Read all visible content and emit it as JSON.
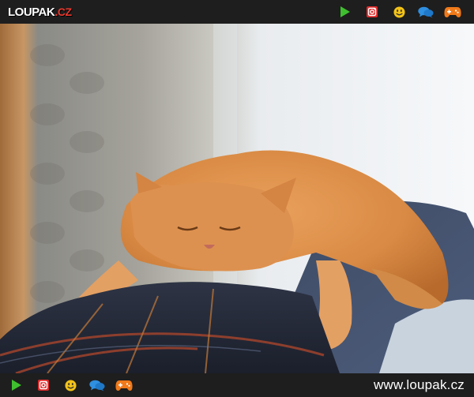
{
  "header": {
    "logo": {
      "main": "LOUPAK",
      "dot": ".",
      "tld": "CZ"
    },
    "icons": [
      "play-icon",
      "instagram-icon",
      "smiley-icon",
      "chat-bubbles-icon",
      "gamepad-icon"
    ]
  },
  "photo": {
    "subject": "cat-photo"
  },
  "footer": {
    "icons": [
      "play-icon",
      "instagram-icon",
      "smiley-icon",
      "chat-bubbles-icon",
      "gamepad-icon"
    ],
    "url": "www.loupak.cz"
  },
  "colors": {
    "bar_bg": "#1e1e1e",
    "play": "#3fbf2f",
    "instagram": "#e02a2a",
    "smiley": "#f3c317",
    "chat": "#2f8fe0",
    "gamepad": "#f07a1a",
    "logo_accent": "#e8392e"
  }
}
